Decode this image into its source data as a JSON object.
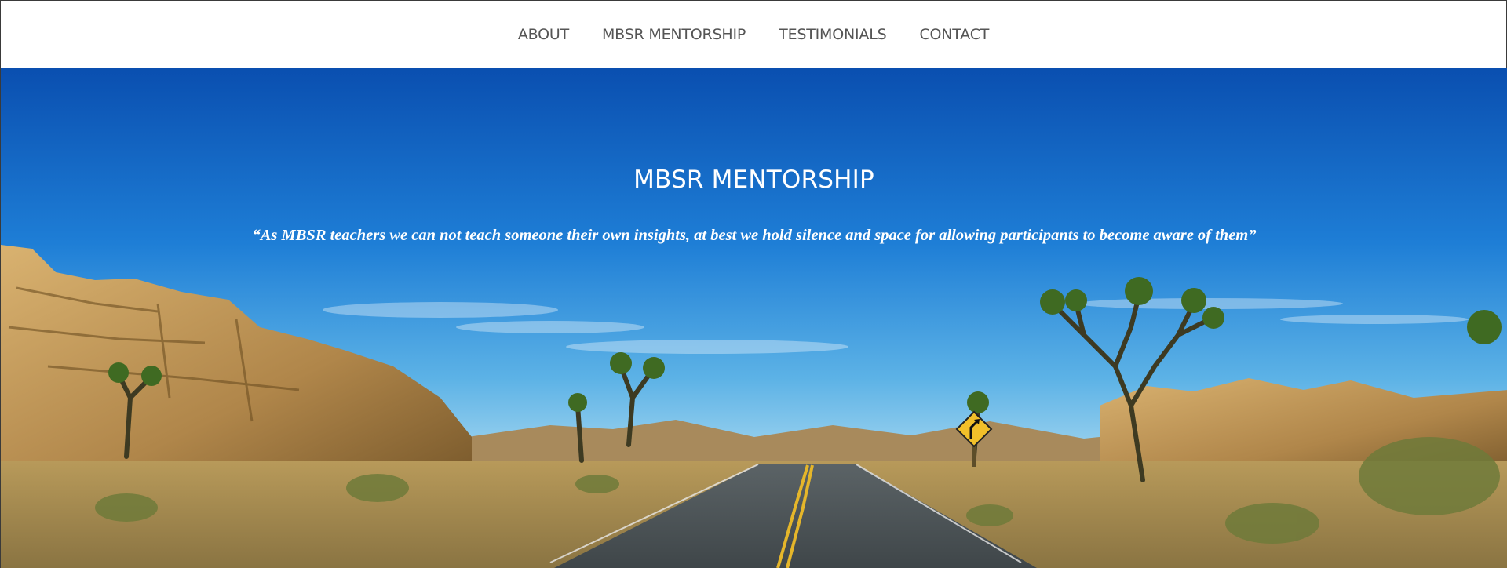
{
  "nav": {
    "items": [
      {
        "label": "ABOUT"
      },
      {
        "label": "MBSR MENTORSHIP"
      },
      {
        "label": "TESTIMONIALS"
      },
      {
        "label": "CONTACT"
      }
    ]
  },
  "hero": {
    "title": "MBSR MENTORSHIP",
    "quote": "“As MBSR teachers we can not teach someone their own insights, at best we hold silence and space for allowing participants to become aware of them”"
  },
  "colors": {
    "nav_text": "#555555",
    "sky_top": "#0a54b6",
    "sky_bottom": "#8ec9ea",
    "hero_text": "#ffffff"
  }
}
